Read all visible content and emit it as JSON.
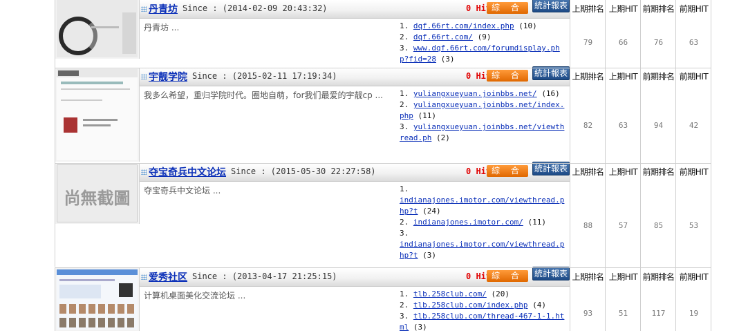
{
  "colors": {
    "link": "#0a2fb8",
    "hit": "#e00000",
    "btn_orange": "#ff9a3a",
    "btn_blue": "#1d4a86"
  },
  "stat_headers": [
    "上期排名",
    "上期HIT",
    "前期排名",
    "前期HIT"
  ],
  "sites": [
    {
      "name": "丹青坊",
      "since": "Since : (2014-02-09 20:43:32)",
      "hit": "0 Hit",
      "btn_all": "綜 合",
      "btn_stat": "統計報表",
      "desc": "丹青坊 ...",
      "links": [
        {
          "num": "1.",
          "url": "dqf.66rt.com/index.php",
          "count": "(10)"
        },
        {
          "num": "2.",
          "url": "dqf.66rt.com/",
          "count": "(9)"
        },
        {
          "num": "3.",
          "url": "www.dqf.66rt.com/forumdisplay.php?fid=28",
          "count": "(3)"
        }
      ],
      "stats": [
        "79",
        "66",
        "76",
        "63"
      ],
      "thumb": "calligraphy-ink-thumbnail"
    },
    {
      "name": "宇靓学院",
      "since": "Since : (2015-02-11 17:19:34)",
      "hit": "0 Hit",
      "btn_all": "綜 合",
      "btn_stat": "統計報表",
      "desc": "我多么希望，重归学院时代。圈地自萌，for我们最爱的宇靓cp ...",
      "links": [
        {
          "num": "1.",
          "url": "yuliangxueyuan.joinbbs.net/",
          "count": "(16)"
        },
        {
          "num": "2.",
          "url": "yuliangxueyuan.joinbbs.net/index.php",
          "count": "(11)"
        },
        {
          "num": "3.",
          "url": "yuliangxueyuan.joinbbs.net/viewthread.ph",
          "count": "(2)"
        }
      ],
      "stats": [
        "82",
        "63",
        "94",
        "42"
      ],
      "thumb": "discuz-forum-thumbnail"
    },
    {
      "name": "夺宝奇兵中文论坛",
      "since": "Since : (2015-05-30 22:27:58)",
      "hit": "0 Hit",
      "btn_all": "綜 合",
      "btn_stat": "統計報表",
      "desc": "夺宝奇兵中文论坛 ...",
      "links": [
        {
          "num": "1.",
          "url": "indianajones.imotor.com/viewthread.php?t",
          "count": "(24)"
        },
        {
          "num": "2.",
          "url": "indianajones.imotor.com/",
          "count": "(11)"
        },
        {
          "num": "3.",
          "url": "indianajones.imotor.com/viewthread.php?t",
          "count": "(3)"
        }
      ],
      "stats": [
        "88",
        "57",
        "85",
        "53"
      ],
      "thumb_text": "尚無截圖"
    },
    {
      "name": "爱秀社区",
      "since": "Since : (2013-04-17 21:25:15)",
      "hit": "0 Hit",
      "btn_all": "綜 合",
      "btn_stat": "統計報表",
      "desc": "计算机桌面美化交流论坛 ...",
      "links": [
        {
          "num": "1.",
          "url": "tlb.258club.com/",
          "count": "(20)"
        },
        {
          "num": "2.",
          "url": "tlb.258club.com/index.php",
          "count": "(4)"
        },
        {
          "num": "3.",
          "url": "tlb.258club.com/thread-467-1-1.html",
          "count": "(3)"
        }
      ],
      "stats": [
        "93",
        "51",
        "117",
        "19"
      ],
      "thumb": "desktop-forum-thumbnail"
    }
  ]
}
